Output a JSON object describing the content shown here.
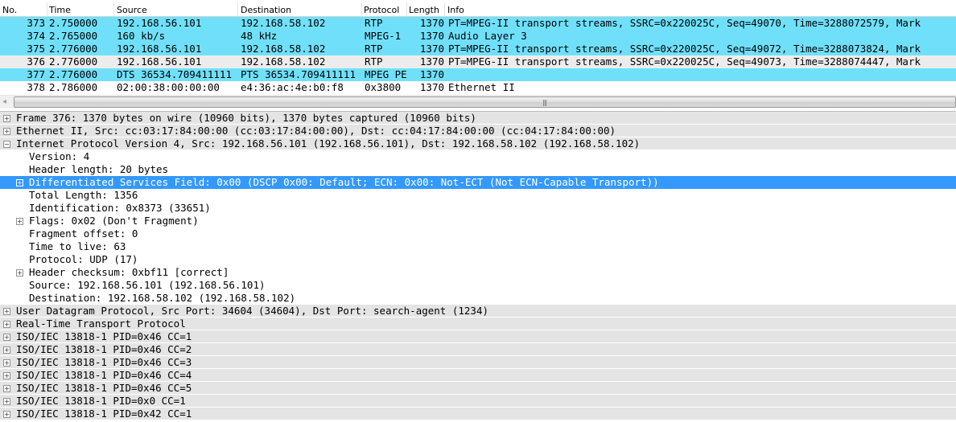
{
  "colors": {
    "row_highlight": "#70e0fa",
    "row_selected_gray": "#ececec",
    "row_normal": "#ffffff",
    "tree_top_bg": "#e4e4e4",
    "tree_selected_bg": "#3399ff"
  },
  "packet_list": {
    "columns": [
      "No.",
      "Time",
      "Source",
      "Destination",
      "Protocol",
      "Length",
      "Info"
    ],
    "rows": [
      {
        "no": "373",
        "time": "2.750000",
        "source": "192.168.56.101",
        "destination": "192.168.58.102",
        "protocol": "RTP",
        "length": "1370",
        "info": "PT=MPEG-II transport streams, SSRC=0x220025C, Seq=49070, Time=3288072579, Mark",
        "style": "highlight"
      },
      {
        "no": "374",
        "time": "2.765000",
        "source": "160 kb/s",
        "destination": "48 kHz",
        "protocol": "MPEG-1",
        "length": "1370",
        "info": "Audio Layer 3",
        "style": "highlight"
      },
      {
        "no": "375",
        "time": "2.776000",
        "source": "192.168.56.101",
        "destination": "192.168.58.102",
        "protocol": "RTP",
        "length": "1370",
        "info": "PT=MPEG-II transport streams, SSRC=0x220025C, Seq=49072, Time=3288073824, Mark",
        "style": "highlight"
      },
      {
        "no": "376",
        "time": "2.776000",
        "source": "192.168.56.101",
        "destination": "192.168.58.102",
        "protocol": "RTP",
        "length": "1370",
        "info": "PT=MPEG-II transport streams, SSRC=0x220025C, Seq=49073, Time=3288074447, Mark",
        "style": "selected"
      },
      {
        "no": "377",
        "time": "2.776000",
        "source": "DTS 36534.709411111",
        "destination": "PTS 36534.709411111",
        "protocol": "MPEG PE",
        "length": "1370",
        "info": "",
        "style": "highlight"
      },
      {
        "no": "378",
        "time": "2.786000",
        "source": "02:00:38:00:00:00",
        "destination": "e4:36:ac:4e:b0:f8",
        "protocol": "0x3800",
        "length": "1370",
        "info": "Ethernet II",
        "style": "normal"
      }
    ]
  },
  "scrollbar": {
    "left_arrow": "◂",
    "grip": "|||"
  },
  "details": [
    {
      "text": "Frame 376: 1370 bytes on wire (10960 bits), 1370 bytes captured (10960 bits)",
      "level": 0,
      "expander": "plus",
      "style": "top"
    },
    {
      "text": "Ethernet II, Src: cc:03:17:84:00:00 (cc:03:17:84:00:00), Dst: cc:04:17:84:00:00 (cc:04:17:84:00:00)",
      "level": 0,
      "expander": "plus",
      "style": "top"
    },
    {
      "text": "Internet Protocol Version 4, Src: 192.168.56.101 (192.168.56.101), Dst: 192.168.58.102 (192.168.58.102)",
      "level": 0,
      "expander": "minus",
      "style": "top"
    },
    {
      "text": "Version: 4",
      "level": 1,
      "expander": "none",
      "style": "plain"
    },
    {
      "text": "Header length: 20 bytes",
      "level": 1,
      "expander": "none",
      "style": "plain"
    },
    {
      "text": "Differentiated Services Field: 0x00 (DSCP 0x00: Default; ECN: 0x00: Not-ECT (Not ECN-Capable Transport))",
      "level": 1,
      "expander": "plus",
      "style": "selected"
    },
    {
      "text": "Total Length: 1356",
      "level": 1,
      "expander": "none",
      "style": "plain"
    },
    {
      "text": "Identification: 0x8373 (33651)",
      "level": 1,
      "expander": "none",
      "style": "plain"
    },
    {
      "text": "Flags: 0x02 (Don't Fragment)",
      "level": 1,
      "expander": "plus",
      "style": "plain"
    },
    {
      "text": "Fragment offset: 0",
      "level": 1,
      "expander": "none",
      "style": "plain"
    },
    {
      "text": "Time to live: 63",
      "level": 1,
      "expander": "none",
      "style": "plain"
    },
    {
      "text": "Protocol: UDP (17)",
      "level": 1,
      "expander": "none",
      "style": "plain"
    },
    {
      "text": "Header checksum: 0xbf11 [correct]",
      "level": 1,
      "expander": "plus",
      "style": "plain"
    },
    {
      "text": "Source: 192.168.56.101 (192.168.56.101)",
      "level": 1,
      "expander": "none",
      "style": "plain"
    },
    {
      "text": "Destination: 192.168.58.102 (192.168.58.102)",
      "level": 1,
      "expander": "none",
      "style": "plain"
    },
    {
      "text": "User Datagram Protocol, Src Port: 34604 (34604), Dst Port: search-agent (1234)",
      "level": 0,
      "expander": "plus",
      "style": "top"
    },
    {
      "text": "Real-Time Transport Protocol",
      "level": 0,
      "expander": "plus",
      "style": "top"
    },
    {
      "text": "ISO/IEC 13818-1 PID=0x46 CC=1",
      "level": 0,
      "expander": "plus",
      "style": "top"
    },
    {
      "text": "ISO/IEC 13818-1 PID=0x46 CC=2",
      "level": 0,
      "expander": "plus",
      "style": "top"
    },
    {
      "text": "ISO/IEC 13818-1 PID=0x46 CC=3",
      "level": 0,
      "expander": "plus",
      "style": "top"
    },
    {
      "text": "ISO/IEC 13818-1 PID=0x46 CC=4",
      "level": 0,
      "expander": "plus",
      "style": "top"
    },
    {
      "text": "ISO/IEC 13818-1 PID=0x46 CC=5",
      "level": 0,
      "expander": "plus",
      "style": "top"
    },
    {
      "text": "ISO/IEC 13818-1 PID=0x0 CC=1",
      "level": 0,
      "expander": "plus",
      "style": "top"
    },
    {
      "text": "ISO/IEC 13818-1 PID=0x42 CC=1",
      "level": 0,
      "expander": "plus",
      "style": "top"
    }
  ]
}
